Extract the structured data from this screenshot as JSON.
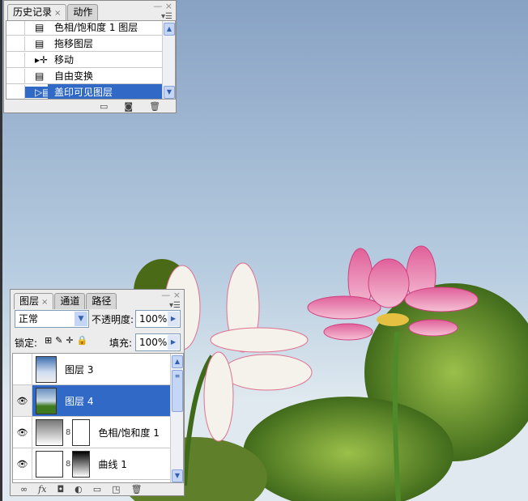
{
  "history_panel": {
    "tabs": [
      "历史记录",
      "动作"
    ],
    "close": "×",
    "items": [
      {
        "label": "色相/饱和度 1 图层",
        "icon": "layer-step-icon"
      },
      {
        "label": "拖移图层",
        "icon": "layer-step-icon"
      },
      {
        "label": "移动",
        "icon": "move-tool-icon"
      },
      {
        "label": "自由变换",
        "icon": "layer-step-icon"
      },
      {
        "label": "盖印可见图层",
        "icon": "layer-step-icon",
        "selected": true
      }
    ]
  },
  "layers_panel": {
    "tabs": [
      "图层",
      "通道",
      "路径"
    ],
    "close": "×",
    "blend_mode": "正常",
    "opacity_label": "不透明度:",
    "opacity": "100%",
    "lock_label": "锁定:",
    "fill_label": "填充:",
    "fill": "100%",
    "layers": [
      {
        "name": "图层 3",
        "visible": false
      },
      {
        "name": "图层 4",
        "visible": true,
        "selected": true
      },
      {
        "name": "色相/饱和度 1",
        "visible": true
      },
      {
        "name": "曲线 1",
        "visible": true
      }
    ],
    "footer_icons": [
      "link-icon",
      "fx-icon",
      "mask-icon",
      "adjustment-icon",
      "folder-icon",
      "new-layer-icon",
      "trash-icon"
    ],
    "fx": "fx"
  },
  "colors": {
    "selection": "#3169c6",
    "panel": "#ececec"
  }
}
